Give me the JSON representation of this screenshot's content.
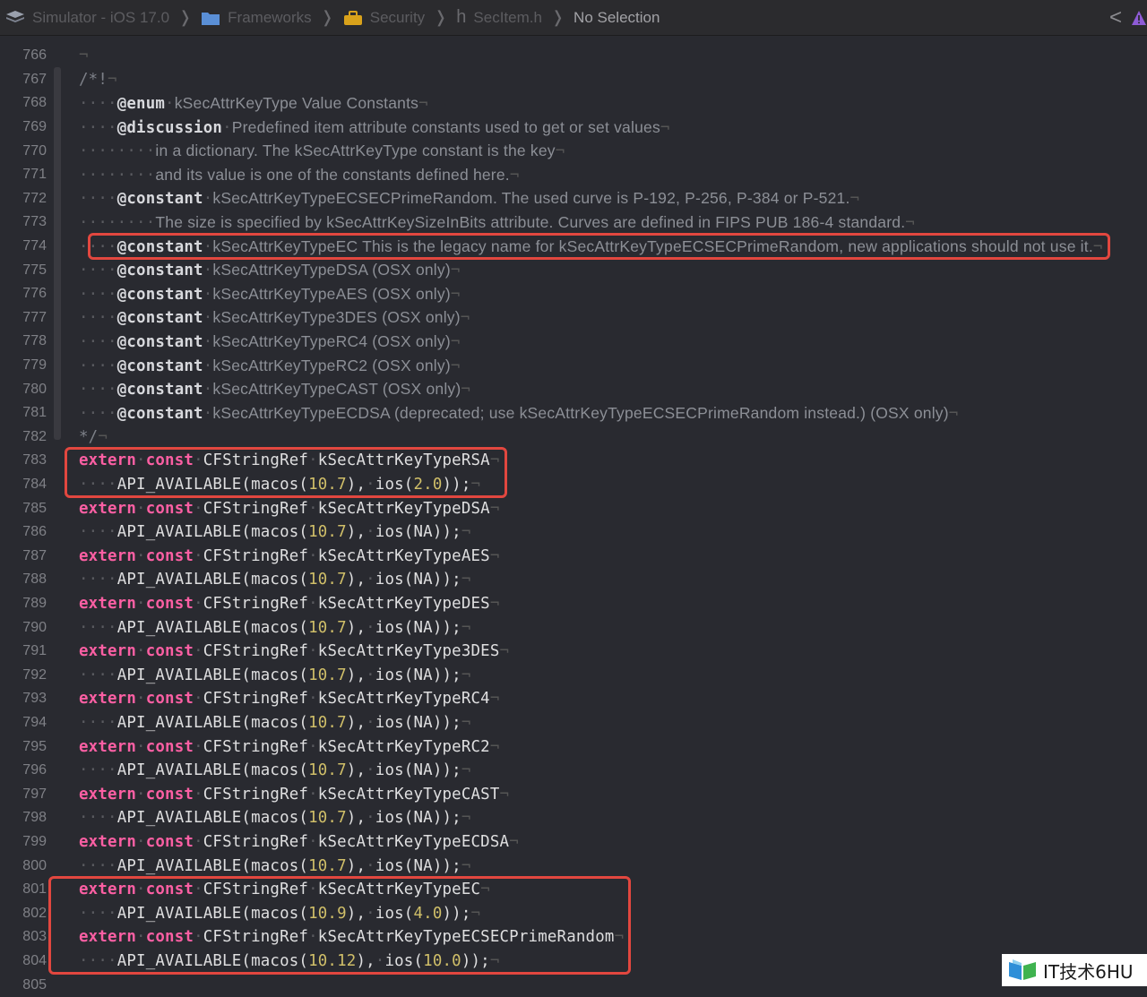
{
  "breadcrumbs": [
    {
      "label": "Simulator - iOS 17.0",
      "icon": "device-icon"
    },
    {
      "label": "Frameworks",
      "icon": "folder-icon"
    },
    {
      "label": "Security",
      "icon": "toolbox-icon"
    },
    {
      "label": "SecItem.h",
      "icon": "header-file-icon",
      "glyph": "h"
    },
    {
      "label": "No Selection",
      "icon": ""
    }
  ],
  "jumpbar_right": {
    "back_glyph": "<",
    "icon": "warning-icon"
  },
  "colors": {
    "keyword": "#fc5fa3",
    "number": "#d0bf69",
    "comment": "#7d8088",
    "highlight": "#e2473f",
    "background": "#292a30"
  },
  "lines": [
    {
      "n": "766",
      "parts": [
        [
          "nl",
          "¬"
        ]
      ]
    },
    {
      "n": "767",
      "parts": [
        [
          "cmt",
          "/*!"
        ],
        [
          "nl",
          "¬"
        ]
      ]
    },
    {
      "n": "768",
      "parts": [
        [
          "ind",
          "····"
        ],
        [
          "doctag",
          "@enum"
        ],
        [
          "ind",
          "·"
        ],
        [
          "prose",
          "kSecAttrKeyType Value Constants"
        ],
        [
          "nl",
          "¬"
        ]
      ]
    },
    {
      "n": "769",
      "parts": [
        [
          "ind",
          "····"
        ],
        [
          "doctag",
          "@discussion"
        ],
        [
          "ind",
          "·"
        ],
        [
          "prose",
          "Predefined item attribute constants used to get or set values"
        ],
        [
          "nl",
          "¬"
        ]
      ]
    },
    {
      "n": "770",
      "parts": [
        [
          "ind",
          "········"
        ],
        [
          "prose",
          "in a dictionary. The kSecAttrKeyType constant is the key"
        ],
        [
          "nl",
          "¬"
        ]
      ]
    },
    {
      "n": "771",
      "parts": [
        [
          "ind",
          "········"
        ],
        [
          "prose",
          "and its value is one of the constants defined here."
        ],
        [
          "nl",
          "¬"
        ]
      ]
    },
    {
      "n": "772",
      "parts": [
        [
          "ind",
          "····"
        ],
        [
          "doctag",
          "@constant"
        ],
        [
          "ind",
          "·"
        ],
        [
          "prose",
          "kSecAttrKeyTypeECSECPrimeRandom. The used curve is P-192, P-256, P-384 or P-521."
        ],
        [
          "nl",
          "¬"
        ]
      ]
    },
    {
      "n": "773",
      "parts": [
        [
          "ind",
          "········"
        ],
        [
          "prose",
          "The size is specified by kSecAttrKeySizeInBits attribute. Curves are defined in FIPS PUB 186-4 standard."
        ],
        [
          "nl",
          "¬"
        ]
      ]
    },
    {
      "n": "774",
      "parts": [
        [
          "ind",
          "····"
        ],
        [
          "doctag",
          "@constant"
        ],
        [
          "ind",
          "·"
        ],
        [
          "prose",
          "kSecAttrKeyTypeEC This is the legacy name for kSecAttrKeyTypeECSECPrimeRandom, new applications should not use it."
        ],
        [
          "nl",
          "¬"
        ]
      ]
    },
    {
      "n": "775",
      "parts": [
        [
          "ind",
          "····"
        ],
        [
          "doctag",
          "@constant"
        ],
        [
          "ind",
          "·"
        ],
        [
          "prose",
          "kSecAttrKeyTypeDSA (OSX only)"
        ],
        [
          "nl",
          "¬"
        ]
      ]
    },
    {
      "n": "776",
      "parts": [
        [
          "ind",
          "····"
        ],
        [
          "doctag",
          "@constant"
        ],
        [
          "ind",
          "·"
        ],
        [
          "prose",
          "kSecAttrKeyTypeAES (OSX only)"
        ],
        [
          "nl",
          "¬"
        ]
      ]
    },
    {
      "n": "777",
      "parts": [
        [
          "ind",
          "····"
        ],
        [
          "doctag",
          "@constant"
        ],
        [
          "ind",
          "·"
        ],
        [
          "prose",
          "kSecAttrKeyType3DES (OSX only)"
        ],
        [
          "nl",
          "¬"
        ]
      ]
    },
    {
      "n": "778",
      "parts": [
        [
          "ind",
          "····"
        ],
        [
          "doctag",
          "@constant"
        ],
        [
          "ind",
          "·"
        ],
        [
          "prose",
          "kSecAttrKeyTypeRC4 (OSX only)"
        ],
        [
          "nl",
          "¬"
        ]
      ]
    },
    {
      "n": "779",
      "parts": [
        [
          "ind",
          "····"
        ],
        [
          "doctag",
          "@constant"
        ],
        [
          "ind",
          "·"
        ],
        [
          "prose",
          "kSecAttrKeyTypeRC2 (OSX only)"
        ],
        [
          "nl",
          "¬"
        ]
      ]
    },
    {
      "n": "780",
      "parts": [
        [
          "ind",
          "····"
        ],
        [
          "doctag",
          "@constant"
        ],
        [
          "ind",
          "·"
        ],
        [
          "prose",
          "kSecAttrKeyTypeCAST (OSX only)"
        ],
        [
          "nl",
          "¬"
        ]
      ]
    },
    {
      "n": "781",
      "parts": [
        [
          "ind",
          "····"
        ],
        [
          "doctag",
          "@constant"
        ],
        [
          "ind",
          "·"
        ],
        [
          "prose",
          "kSecAttrKeyTypeECDSA (deprecated; use kSecAttrKeyTypeECSECPrimeRandom instead.) (OSX only)"
        ],
        [
          "nl",
          "¬"
        ]
      ]
    },
    {
      "n": "782",
      "parts": [
        [
          "cmt",
          "*/"
        ],
        [
          "nl",
          "¬"
        ]
      ]
    },
    {
      "n": "783",
      "parts": [
        [
          "kw",
          "extern"
        ],
        [
          "ind",
          "·"
        ],
        [
          "kw",
          "const"
        ],
        [
          "ind",
          "·"
        ],
        [
          "ty",
          "CFStringRef"
        ],
        [
          "ind",
          "·"
        ],
        [
          "ty",
          "kSecAttrKeyTypeRSA"
        ],
        [
          "nl",
          "¬"
        ]
      ]
    },
    {
      "n": "784",
      "parts": [
        [
          "ind",
          "····"
        ],
        [
          "pl",
          "API_AVAILABLE(macos("
        ],
        [
          "num",
          "10.7"
        ],
        [
          "pl",
          "),"
        ],
        [
          "ind",
          "·"
        ],
        [
          "pl",
          "ios("
        ],
        [
          "num",
          "2.0"
        ],
        [
          "pl",
          "));"
        ],
        [
          "nl",
          "¬"
        ]
      ]
    },
    {
      "n": "785",
      "parts": [
        [
          "kw",
          "extern"
        ],
        [
          "ind",
          "·"
        ],
        [
          "kw",
          "const"
        ],
        [
          "ind",
          "·"
        ],
        [
          "ty",
          "CFStringRef"
        ],
        [
          "ind",
          "·"
        ],
        [
          "ty",
          "kSecAttrKeyTypeDSA"
        ],
        [
          "nl",
          "¬"
        ]
      ]
    },
    {
      "n": "786",
      "parts": [
        [
          "ind",
          "····"
        ],
        [
          "pl",
          "API_AVAILABLE(macos("
        ],
        [
          "num",
          "10.7"
        ],
        [
          "pl",
          "),"
        ],
        [
          "ind",
          "·"
        ],
        [
          "pl",
          "ios(NA));"
        ],
        [
          "nl",
          "¬"
        ]
      ]
    },
    {
      "n": "787",
      "parts": [
        [
          "kw",
          "extern"
        ],
        [
          "ind",
          "·"
        ],
        [
          "kw",
          "const"
        ],
        [
          "ind",
          "·"
        ],
        [
          "ty",
          "CFStringRef"
        ],
        [
          "ind",
          "·"
        ],
        [
          "ty",
          "kSecAttrKeyTypeAES"
        ],
        [
          "nl",
          "¬"
        ]
      ]
    },
    {
      "n": "788",
      "parts": [
        [
          "ind",
          "····"
        ],
        [
          "pl",
          "API_AVAILABLE(macos("
        ],
        [
          "num",
          "10.7"
        ],
        [
          "pl",
          "),"
        ],
        [
          "ind",
          "·"
        ],
        [
          "pl",
          "ios(NA));"
        ],
        [
          "nl",
          "¬"
        ]
      ]
    },
    {
      "n": "789",
      "parts": [
        [
          "kw",
          "extern"
        ],
        [
          "ind",
          "·"
        ],
        [
          "kw",
          "const"
        ],
        [
          "ind",
          "·"
        ],
        [
          "ty",
          "CFStringRef"
        ],
        [
          "ind",
          "·"
        ],
        [
          "ty",
          "kSecAttrKeyTypeDES"
        ],
        [
          "nl",
          "¬"
        ]
      ]
    },
    {
      "n": "790",
      "parts": [
        [
          "ind",
          "····"
        ],
        [
          "pl",
          "API_AVAILABLE(macos("
        ],
        [
          "num",
          "10.7"
        ],
        [
          "pl",
          "),"
        ],
        [
          "ind",
          "·"
        ],
        [
          "pl",
          "ios(NA));"
        ],
        [
          "nl",
          "¬"
        ]
      ]
    },
    {
      "n": "791",
      "parts": [
        [
          "kw",
          "extern"
        ],
        [
          "ind",
          "·"
        ],
        [
          "kw",
          "const"
        ],
        [
          "ind",
          "·"
        ],
        [
          "ty",
          "CFStringRef"
        ],
        [
          "ind",
          "·"
        ],
        [
          "ty",
          "kSecAttrKeyType3DES"
        ],
        [
          "nl",
          "¬"
        ]
      ]
    },
    {
      "n": "792",
      "parts": [
        [
          "ind",
          "····"
        ],
        [
          "pl",
          "API_AVAILABLE(macos("
        ],
        [
          "num",
          "10.7"
        ],
        [
          "pl",
          "),"
        ],
        [
          "ind",
          "·"
        ],
        [
          "pl",
          "ios(NA));"
        ],
        [
          "nl",
          "¬"
        ]
      ]
    },
    {
      "n": "793",
      "parts": [
        [
          "kw",
          "extern"
        ],
        [
          "ind",
          "·"
        ],
        [
          "kw",
          "const"
        ],
        [
          "ind",
          "·"
        ],
        [
          "ty",
          "CFStringRef"
        ],
        [
          "ind",
          "·"
        ],
        [
          "ty",
          "kSecAttrKeyTypeRC4"
        ],
        [
          "nl",
          "¬"
        ]
      ]
    },
    {
      "n": "794",
      "parts": [
        [
          "ind",
          "····"
        ],
        [
          "pl",
          "API_AVAILABLE(macos("
        ],
        [
          "num",
          "10.7"
        ],
        [
          "pl",
          "),"
        ],
        [
          "ind",
          "·"
        ],
        [
          "pl",
          "ios(NA));"
        ],
        [
          "nl",
          "¬"
        ]
      ]
    },
    {
      "n": "795",
      "parts": [
        [
          "kw",
          "extern"
        ],
        [
          "ind",
          "·"
        ],
        [
          "kw",
          "const"
        ],
        [
          "ind",
          "·"
        ],
        [
          "ty",
          "CFStringRef"
        ],
        [
          "ind",
          "·"
        ],
        [
          "ty",
          "kSecAttrKeyTypeRC2"
        ],
        [
          "nl",
          "¬"
        ]
      ]
    },
    {
      "n": "796",
      "parts": [
        [
          "ind",
          "····"
        ],
        [
          "pl",
          "API_AVAILABLE(macos("
        ],
        [
          "num",
          "10.7"
        ],
        [
          "pl",
          "),"
        ],
        [
          "ind",
          "·"
        ],
        [
          "pl",
          "ios(NA));"
        ],
        [
          "nl",
          "¬"
        ]
      ]
    },
    {
      "n": "797",
      "parts": [
        [
          "kw",
          "extern"
        ],
        [
          "ind",
          "·"
        ],
        [
          "kw",
          "const"
        ],
        [
          "ind",
          "·"
        ],
        [
          "ty",
          "CFStringRef"
        ],
        [
          "ind",
          "·"
        ],
        [
          "ty",
          "kSecAttrKeyTypeCAST"
        ],
        [
          "nl",
          "¬"
        ]
      ]
    },
    {
      "n": "798",
      "parts": [
        [
          "ind",
          "····"
        ],
        [
          "pl",
          "API_AVAILABLE(macos("
        ],
        [
          "num",
          "10.7"
        ],
        [
          "pl",
          "),"
        ],
        [
          "ind",
          "·"
        ],
        [
          "pl",
          "ios(NA));"
        ],
        [
          "nl",
          "¬"
        ]
      ]
    },
    {
      "n": "799",
      "parts": [
        [
          "kw",
          "extern"
        ],
        [
          "ind",
          "·"
        ],
        [
          "kw",
          "const"
        ],
        [
          "ind",
          "·"
        ],
        [
          "ty",
          "CFStringRef"
        ],
        [
          "ind",
          "·"
        ],
        [
          "ty",
          "kSecAttrKeyTypeECDSA"
        ],
        [
          "nl",
          "¬"
        ]
      ]
    },
    {
      "n": "800",
      "parts": [
        [
          "ind",
          "····"
        ],
        [
          "pl",
          "API_AVAILABLE(macos("
        ],
        [
          "num",
          "10.7"
        ],
        [
          "pl",
          "),"
        ],
        [
          "ind",
          "·"
        ],
        [
          "pl",
          "ios(NA));"
        ],
        [
          "nl",
          "¬"
        ]
      ]
    },
    {
      "n": "801",
      "parts": [
        [
          "kw",
          "extern"
        ],
        [
          "ind",
          "·"
        ],
        [
          "kw",
          "const"
        ],
        [
          "ind",
          "·"
        ],
        [
          "ty",
          "CFStringRef"
        ],
        [
          "ind",
          "·"
        ],
        [
          "ty",
          "kSecAttrKeyTypeEC"
        ],
        [
          "nl",
          "¬"
        ]
      ]
    },
    {
      "n": "802",
      "parts": [
        [
          "ind",
          "····"
        ],
        [
          "pl",
          "API_AVAILABLE(macos("
        ],
        [
          "num",
          "10.9"
        ],
        [
          "pl",
          "),"
        ],
        [
          "ind",
          "·"
        ],
        [
          "pl",
          "ios("
        ],
        [
          "num",
          "4.0"
        ],
        [
          "pl",
          "));"
        ],
        [
          "nl",
          "¬"
        ]
      ]
    },
    {
      "n": "803",
      "parts": [
        [
          "kw",
          "extern"
        ],
        [
          "ind",
          "·"
        ],
        [
          "kw",
          "const"
        ],
        [
          "ind",
          "·"
        ],
        [
          "ty",
          "CFStringRef"
        ],
        [
          "ind",
          "·"
        ],
        [
          "ty",
          "kSecAttrKeyTypeECSECPrimeRandom"
        ],
        [
          "nl",
          "¬"
        ]
      ]
    },
    {
      "n": "804",
      "parts": [
        [
          "ind",
          "····"
        ],
        [
          "pl",
          "API_AVAILABLE(macos("
        ],
        [
          "num",
          "10.12"
        ],
        [
          "pl",
          "),"
        ],
        [
          "ind",
          "·"
        ],
        [
          "pl",
          "ios("
        ],
        [
          "num",
          "10.0"
        ],
        [
          "pl",
          "));"
        ],
        [
          "nl",
          "¬"
        ]
      ]
    },
    {
      "n": "805",
      "parts": []
    }
  ],
  "highlighted_lines": [
    [
      "774",
      "774"
    ],
    [
      "783",
      "784"
    ],
    [
      "801",
      "804"
    ]
  ],
  "watermark": {
    "text": "IT技术6HU"
  }
}
